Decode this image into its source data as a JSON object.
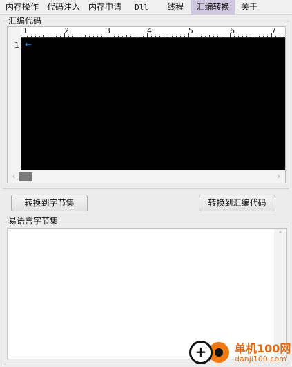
{
  "menu": {
    "items": [
      "内存操作",
      "代码注入",
      "内存申请",
      "Dll",
      "线程",
      "汇编转换",
      "关于"
    ],
    "active_index": 5,
    "active_color": "#cfc7df"
  },
  "asm_group": {
    "title": "汇编代码",
    "ruler_numbers": [
      "1",
      "2",
      "3",
      "4",
      "5",
      "6",
      "7"
    ],
    "line_number": "1",
    "caret_glyph": "←",
    "code_background": "#000000",
    "caret_color": "#4aa3ff"
  },
  "buttons": {
    "to_bytes": "转换到字节集",
    "to_asm": "转换到汇编代码"
  },
  "bytes_group": {
    "title": "易语言字节集",
    "content": ""
  },
  "watermark": {
    "brand": "单机100网",
    "site": "danji100.com",
    "logo_glyph": "+"
  }
}
